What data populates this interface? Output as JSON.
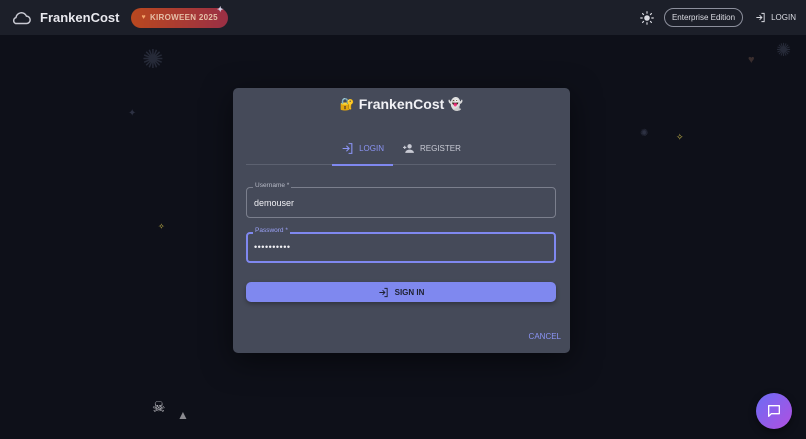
{
  "header": {
    "brand": "FrankenCost",
    "event_badge": "KIROWEEN 2025",
    "edition": "Enterprise Edition",
    "login_label": "LOGIN"
  },
  "dialog": {
    "title": "FrankenCost",
    "tabs": [
      {
        "label": "LOGIN",
        "active": true
      },
      {
        "label": "REGISTER",
        "active": false
      }
    ],
    "username": {
      "label": "Username *",
      "value": "demouser"
    },
    "password": {
      "label": "Password *",
      "value": "••••••••••"
    },
    "signin_label": "SIGN IN",
    "cancel_label": "CANCEL"
  },
  "colors": {
    "accent": "#7f88ef",
    "background": "#0e1019",
    "dialog": "#454a59"
  }
}
